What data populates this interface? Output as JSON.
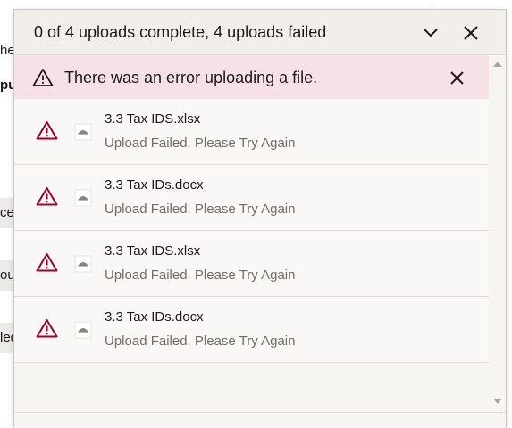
{
  "background": {
    "fragments": [
      "her",
      "pu",
      "ces",
      "ou",
      "led"
    ]
  },
  "panel": {
    "title": "0 of 4 uploads complete, 4 uploads failed",
    "collapse_icon": "chevron-down-icon",
    "close_icon": "close-icon"
  },
  "error_banner": {
    "message": "There was an error uploading a file.",
    "icon": "warning-icon",
    "close_icon": "close-icon"
  },
  "uploads": [
    {
      "name": "3.3 Tax IDS.xlsx",
      "status": "Upload Failed. Please Try Again"
    },
    {
      "name": "3.3 Tax IDs.docx",
      "status": "Upload Failed. Please Try Again"
    },
    {
      "name": "3.3 Tax IDS.xlsx",
      "status": "Upload Failed. Please Try Again"
    },
    {
      "name": "3.3 Tax IDs.docx",
      "status": "Upload Failed. Please Try Again"
    }
  ],
  "colors": {
    "error_accent": "#9b0032",
    "banner_bg": "#f5e1e6",
    "header_bg": "#f2efea"
  }
}
